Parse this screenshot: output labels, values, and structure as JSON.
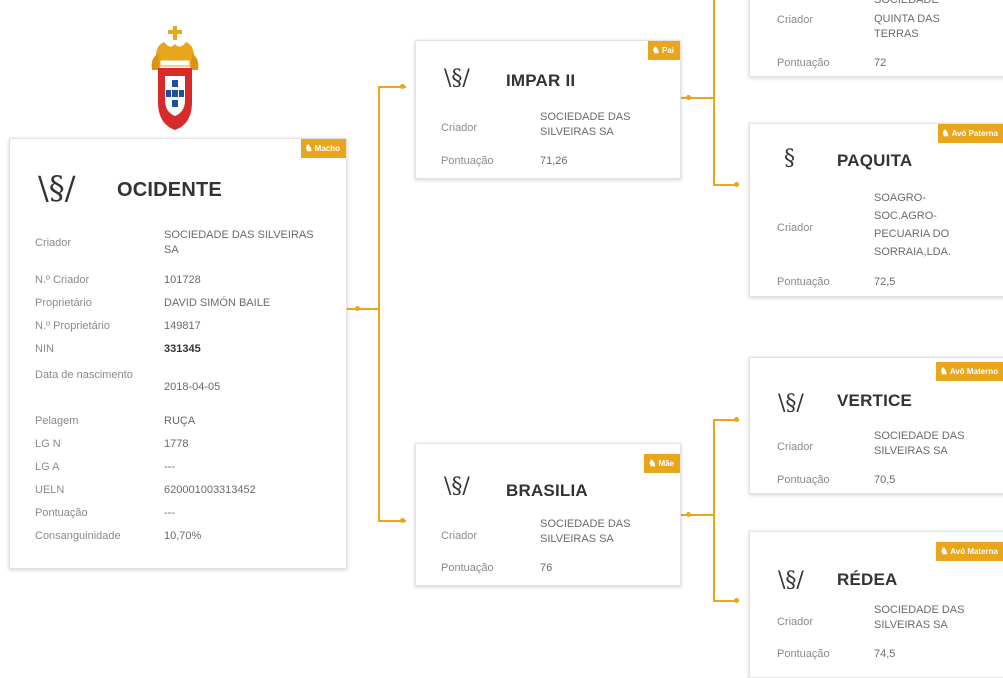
{
  "accent": "#e8a61c",
  "main": {
    "badge": "Macho",
    "brand_icon": "brand-mark-icon",
    "name": "OCIDENTE",
    "fields": [
      {
        "label": "Criador",
        "value": "SOCIEDADE DAS SILVEIRAS SA"
      },
      {
        "label": "N.º Criador",
        "value": "101728"
      },
      {
        "label": "Proprietário",
        "value": "DAVID SIMÓN BAILE"
      },
      {
        "label": "N.º Proprietário",
        "value": "149817"
      },
      {
        "label": "NIN",
        "value": "331345"
      },
      {
        "label": "Data de nascimento",
        "value": "2018-04-05"
      },
      {
        "label": "Pelagem",
        "value": "RUÇA"
      },
      {
        "label": "LG N",
        "value": "1778"
      },
      {
        "label": "LG A",
        "value": "---"
      },
      {
        "label": "UELN",
        "value": "620001003313452"
      },
      {
        "label": "Pontuação",
        "value": "---"
      },
      {
        "label": "Consanguinidade",
        "value": "10,70%"
      }
    ]
  },
  "sire": {
    "badge": "Pai",
    "name": "IMPAR II",
    "criador_label": "Criador",
    "criador": "SOCIEDADE DAS SILVEIRAS SA",
    "pontuacao_label": "Pontuação",
    "pontuacao": "71,26"
  },
  "dam": {
    "badge": "Mãe",
    "name": "BRASILIA",
    "criador_label": "Criador",
    "criador": "SOCIEDADE DAS SILVEIRAS SA",
    "pontuacao_label": "Pontuação",
    "pontuacao": "76"
  },
  "pat_grandsire": {
    "criador_label": "Criador",
    "criador_l1": "SOCIEDADE",
    "criador_l2": "QUINTA DAS",
    "criador_l3": "TERRAS",
    "pontuacao_label": "Pontuação",
    "pontuacao": "72"
  },
  "pat_granddam": {
    "badge": "Avó Paterna",
    "name": "PAQUITA",
    "criador_label": "Criador",
    "criador": "SOAGRO-SOC.AGRO-PECUARIA DO SORRAIA,LDA.",
    "pontuacao_label": "Pontuação",
    "pontuacao": "72,5"
  },
  "mat_grandsire": {
    "badge": "Avô Materno",
    "name": "VERTICE",
    "criador_label": "Criador",
    "criador": "SOCIEDADE DAS SILVEIRAS SA",
    "pontuacao_label": "Pontuação",
    "pontuacao": "70,5"
  },
  "mat_granddam": {
    "badge": "Avó Materna",
    "name": "RÉDEA",
    "criador_label": "Criador",
    "criador": "SOCIEDADE DAS SILVEIRAS SA",
    "pontuacao_label": "Pontuação",
    "pontuacao": "74,5"
  }
}
